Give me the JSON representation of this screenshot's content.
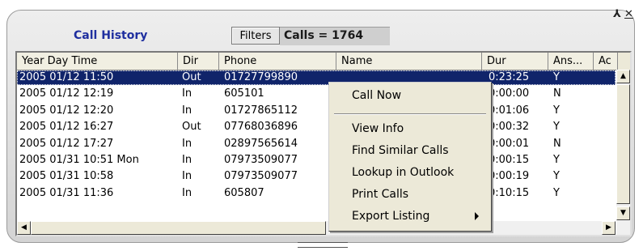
{
  "header": {
    "title": "Call History",
    "filters_label": "Filters",
    "calls_count": "Calls = 1764",
    "pin_icon": "⅄",
    "close_icon": "✕"
  },
  "columns": [
    "Year  Day  Time",
    "Dir",
    "Phone",
    "Name",
    "Dur",
    "Ans...",
    "Ac"
  ],
  "rows": [
    [
      "2005 01/12  11:50",
      "Out",
      "01727799890",
      "",
      "0:23:25",
      "Y"
    ],
    [
      "2005 01/12  12:19",
      "In",
      "605101",
      "",
      "0:00:00",
      "N"
    ],
    [
      "2005 01/12  12:20",
      "In",
      "01727865112",
      "",
      "0:01:06",
      "Y"
    ],
    [
      "2005 01/12  16:27",
      "Out",
      "07768036896",
      "",
      "0:00:32",
      "Y"
    ],
    [
      "2005 01/12  17:27",
      "In",
      "02897565614",
      "",
      "0:00:01",
      "N"
    ],
    [
      "2005 01/31  10:51 Mon",
      "In",
      "07973509077",
      "",
      "0:00:15",
      "Y"
    ],
    [
      "2005 01/31  10:58",
      "In",
      "07973509077",
      "",
      "0:00:19",
      "Y"
    ],
    [
      "2005 01/31  11:36",
      "In",
      "605807",
      "",
      "0:10:15",
      "Y"
    ]
  ],
  "context_menu": {
    "items": [
      "Call Now",
      "View Info",
      "Find Similar Calls",
      "Lookup in Outlook",
      "Print Calls",
      "Export Listing"
    ]
  },
  "colors": {
    "selected_row": "#10246a",
    "title_text": "#1f2f9f"
  }
}
